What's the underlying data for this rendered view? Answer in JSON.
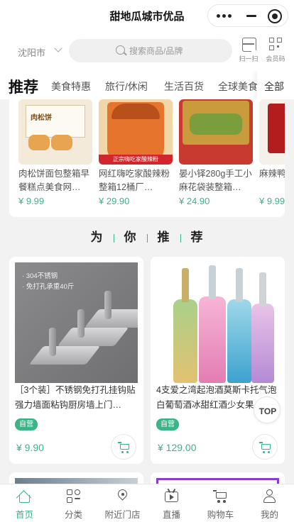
{
  "app": {
    "title": "甜地瓜城市优品"
  },
  "location": {
    "city": "沈阳市"
  },
  "search": {
    "placeholder": "搜索商品/品牌"
  },
  "quick_actions": {
    "scan_label": "扫一扫",
    "vip_label": "会员码"
  },
  "category_tabs": {
    "items": [
      "推荐",
      "美食特惠",
      "旅行/休闲",
      "生活百货",
      "全球美食"
    ],
    "more_label": "全部",
    "active_index": 0
  },
  "featured": {
    "items": [
      {
        "name": "肉松饼面包整箱早餐糕点美食网…",
        "price": "¥ 9.99"
      },
      {
        "name": "网红嗨吃家酸辣粉整箱12桶厂…",
        "price": "¥ 29.90",
        "tag": "正宗嗨吃家酸辣粉"
      },
      {
        "name": "晏小铎280g手工小麻花袋装整箱…",
        "price": "¥ 24.90"
      },
      {
        "name": "麻辣鸭…辣味休…",
        "price": "¥ 9.99"
      }
    ]
  },
  "recommend_section": {
    "chars": [
      "为",
      "你",
      "推",
      "荐"
    ]
  },
  "products": [
    {
      "name": "［3个装］不锈钢免打孔挂钩贴强力墙面粘钩厨房墙上门…",
      "badge": "自营",
      "price": "¥ 9.90",
      "image_text": [
        "· 304不锈钢",
        "· 免打孔承重40斤"
      ]
    },
    {
      "name": "4支爱之湾起泡酒莫斯卡托气泡白葡萄酒冰甜红酒少女果…",
      "badge": "自营",
      "price": "¥ 129.00"
    }
  ],
  "back_to_top": {
    "label": "TOP"
  },
  "tabbar": {
    "items": [
      {
        "label": "首页",
        "icon": "home-icon"
      },
      {
        "label": "分类",
        "icon": "category-icon"
      },
      {
        "label": "附近门店",
        "icon": "location-pin-icon"
      },
      {
        "label": "直播",
        "icon": "live-tv-icon"
      },
      {
        "label": "购物车",
        "icon": "cart-icon"
      },
      {
        "label": "我的",
        "icon": "user-icon"
      }
    ],
    "active_index": 0
  },
  "colors": {
    "accent": "#3db388",
    "background": "#f2f2f2"
  }
}
